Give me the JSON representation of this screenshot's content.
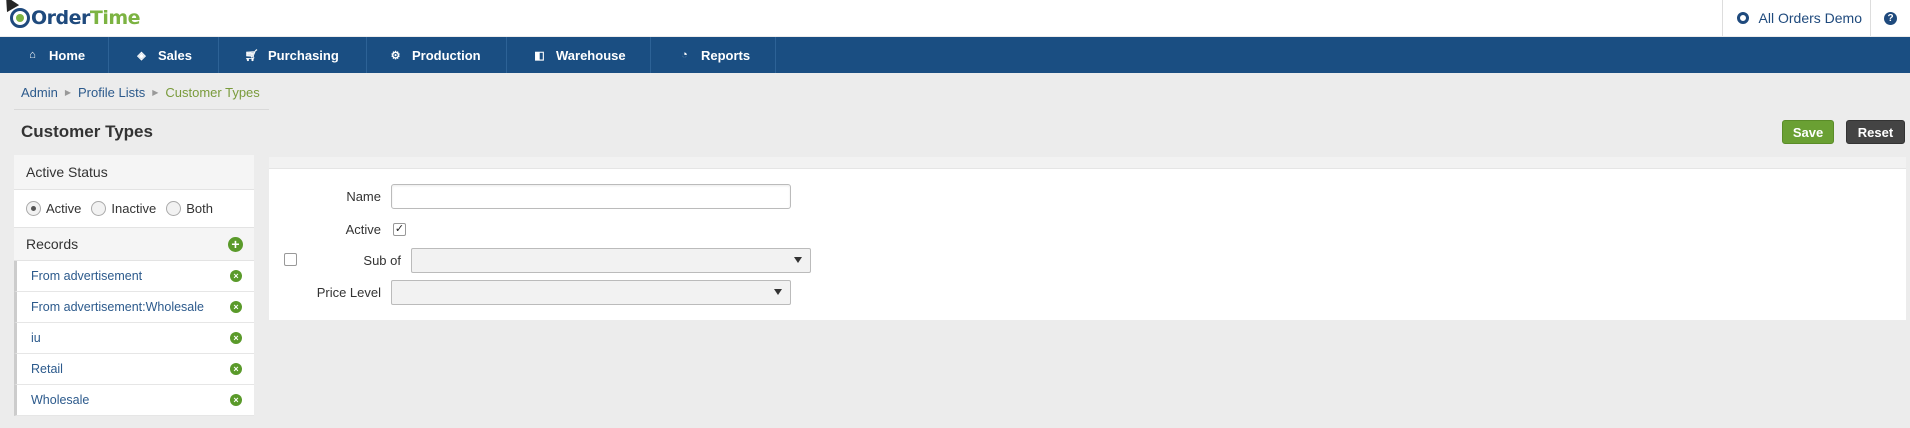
{
  "app": {
    "logo_part1": "Order",
    "logo_part2": "Time"
  },
  "header": {
    "company": "All Orders Demo",
    "help_glyph": "?"
  },
  "nav": {
    "items": [
      {
        "label": "Home",
        "icon": "home-icon"
      },
      {
        "label": "Sales",
        "icon": "tag-icon"
      },
      {
        "label": "Purchasing",
        "icon": "cart-icon"
      },
      {
        "label": "Production",
        "icon": "cogs-icon"
      },
      {
        "label": "Warehouse",
        "icon": "box-icon"
      },
      {
        "label": "Reports",
        "icon": "pie-chart-icon"
      }
    ]
  },
  "breadcrumb": {
    "items": [
      "Admin",
      "Profile Lists"
    ],
    "current": "Customer Types"
  },
  "page": {
    "title": "Customer Types"
  },
  "toolbar": {
    "save_label": "Save",
    "reset_label": "Reset"
  },
  "sidebar": {
    "status_heading": "Active Status",
    "status_options": [
      {
        "label": "Active",
        "selected": true
      },
      {
        "label": "Inactive",
        "selected": false
      },
      {
        "label": "Both",
        "selected": false
      }
    ],
    "records_heading": "Records",
    "records": [
      "From advertisement",
      "From advertisement:Wholesale",
      "iu",
      "Retail",
      "Wholesale"
    ]
  },
  "form": {
    "name_label": "Name",
    "name_value": "",
    "active_label": "Active",
    "active_checked": true,
    "sub_of_label": "Sub of",
    "sub_of_value": "",
    "price_level_label": "Price Level",
    "price_level_value": ""
  },
  "colors": {
    "nav_bg": "#1a4e82",
    "save_green": "#6aa033",
    "brand_green": "#7cb342",
    "brand_blue": "#1f4a7d"
  }
}
